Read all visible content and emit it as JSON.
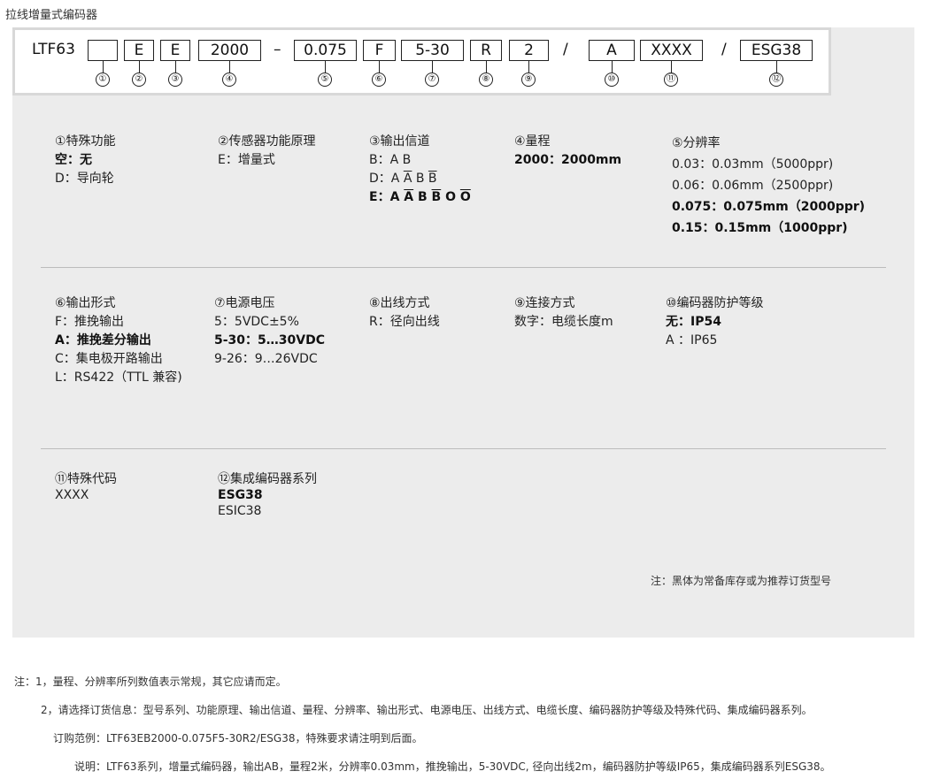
{
  "title": "拉线增量式编码器",
  "model": {
    "prefix": "LTF63",
    "slots": [
      "",
      "E",
      "E",
      "2000",
      "0.075",
      "F",
      "5-30",
      "R",
      "2",
      "A",
      "XXXX",
      "ESG38"
    ],
    "dash": "–",
    "slash1": "/",
    "slash2": "/",
    "markers": [
      "①",
      "②",
      "③",
      "④",
      "⑤",
      "⑥",
      "⑦",
      "⑧",
      "⑨",
      "⑩",
      "⑪",
      "⑫"
    ]
  },
  "spec": {
    "c1": {
      "heading": "①特殊功能",
      "l1": "空：无",
      "l2": "D：导向轮"
    },
    "c2": {
      "heading": "②传感器功能原理",
      "l1": "E：增量式"
    },
    "c3": {
      "heading": "③输出信道",
      "l1": "B：A B",
      "l2_pre": "D：A ",
      "l2_abar": "A",
      "l2_mid": " B ",
      "l2_bbar": "B",
      "l3_pre": "E：A ",
      "l3_abar": "A",
      "l3_mid": " B ",
      "l3_bbar": "B",
      "l3_o": " O ",
      "l3_obar": "O"
    },
    "c4": {
      "heading": "④量程",
      "l1": "2000：2000mm"
    },
    "c5": {
      "heading": "⑤分辨率",
      "l1": "0.03：0.03mm（5000ppr)",
      "l2": "0.06：0.06mm（2500ppr)",
      "l3": "0.075：0.075mm（2000ppr)",
      "l4": "0.15：0.15mm（1000ppr)"
    },
    "c6": {
      "heading": "⑥输出形式",
      "l1": "F：推挽输出",
      "l2": "A：推挽差分输出",
      "l3": "C：集电极开路输出",
      "l4": "L：RS422（TTL 兼容)"
    },
    "c7": {
      "heading": "⑦电源电压",
      "l1": "5：5VDC±5%",
      "l2": "5-30：5…30VDC",
      "l3": "9-26：9…26VDC"
    },
    "c8": {
      "heading": "⑧出线方式",
      "l1": "R：径向出线"
    },
    "c9": {
      "heading": "⑨连接方式",
      "l1": "数字：电缆长度m"
    },
    "c10": {
      "heading": "⑩编码器防护等级",
      "l1": "无：IP54",
      "l2": "A ：IP65"
    },
    "c11": {
      "heading": "⑪特殊代码",
      "l1": "XXXX"
    },
    "c12": {
      "heading": "⑫集成编码器系列",
      "l1": "ESG38",
      "l2": "ESIC38"
    }
  },
  "panel_note": "注：黑体为常备库存或为推荐订货型号",
  "footer": {
    "n1": "注：1，量程、分辨率所列数值表示常规，其它应请而定。",
    "n2": "2，请选择订货信息：型号系列、功能原理、输出信道、量程、分辨率、输出形式、电源电压、出线方式、电缆长度、编码器防护等级及特殊代码、集成编码器系列。",
    "n3": "订购范例：LTF63EB2000-0.075F5-30R2/ESG38，特殊要求请注明到后面。",
    "n4": "说明：LTF63系列，增量式编码器，输出AB，量程2米，分辨率0.03mm，推挽输出，5-30VDC, 径向出线2m，编码器防护等级IP65，集成编码器系列ESG38。"
  }
}
